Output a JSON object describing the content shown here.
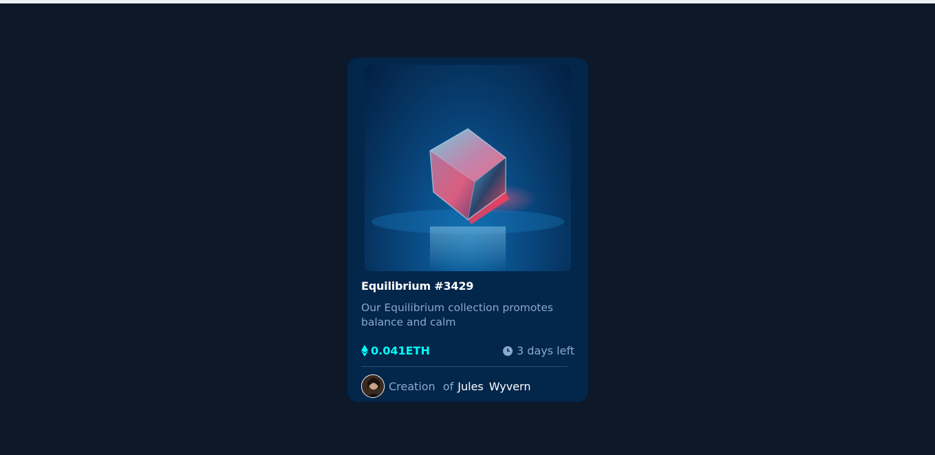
{
  "card": {
    "title": "Equilibrium #3429",
    "description": "Our Equilibrium collection promotes balance and calm",
    "price": "0.041ETH",
    "time_left": "3 days left",
    "creator_prefix": "Creation",
    "creator_of": "of",
    "creator_first": "Jules",
    "creator_last": "Wyvern"
  },
  "icons": {
    "price": "ethereum-icon",
    "time": "clock-icon",
    "image": "equilibrium-cube-image",
    "avatar": "creator-avatar"
  },
  "colors": {
    "page_background": "#0d1829",
    "card_background": "#03264b",
    "accent_cyan": "#00fff7",
    "soft_blue_text": "#8ba9cf",
    "white": "#ffffff",
    "divider": "#2e4d6f"
  }
}
